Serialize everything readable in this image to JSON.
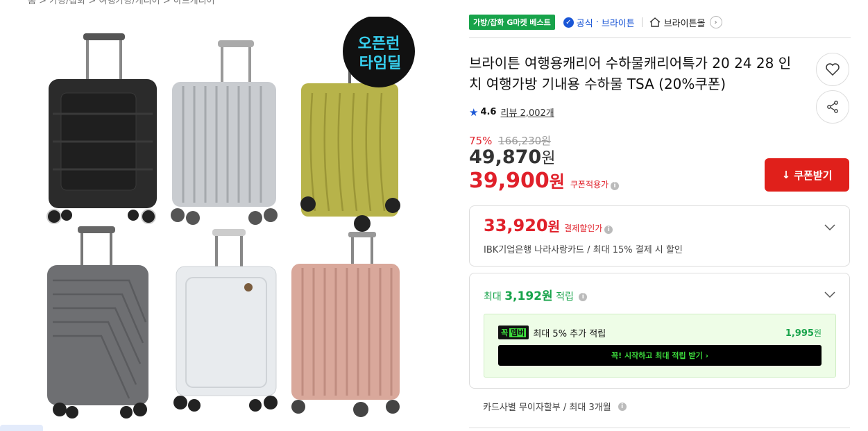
{
  "breadcrumb": {
    "text": "홈 > 가방/잡화 > 여행가방/캐리어 > 하드캐리어"
  },
  "badges": {
    "best": "가방/잡화 G마켓 베스트",
    "official": "공식",
    "brand": "브라이튼",
    "store": "브라이튼몰"
  },
  "product": {
    "title": "브라이튼 여행용캐리어 수하물캐리어특가 20 24 28 인치 여행가방 기내용 수하물 TSA (20%쿠폰)",
    "rating": "4.6",
    "reviews": "리뷰 2,002개"
  },
  "image": {
    "sticker_line1": "오픈런",
    "sticker_line2": "타임딜",
    "colors": [
      "#2b2b2b",
      "#c9ccd0",
      "#b7b34a",
      "#6e6f72",
      "#e8ebee",
      "#d9a89b"
    ]
  },
  "pricing": {
    "discount_pct": "75%",
    "original": "166,230원",
    "sale": "49,870",
    "sale_unit": "원",
    "coupon": "39,900",
    "coupon_unit": "원",
    "coupon_label": "쿠폰적용가",
    "coupon_button": "쿠폰받기"
  },
  "card_discount": {
    "price": "33,920",
    "unit": "원",
    "label": "결제할인가",
    "desc": "IBK기업은행 나라사랑카드 / 최대 15% 결제 시 할인"
  },
  "points": {
    "prefix": "최대 ",
    "amount": "3,192원",
    "suffix": " 적립",
    "member_logo_a": "꼭",
    "member_logo_b": "멤버",
    "member_text": "최대 5% 추가 적립",
    "member_amount": "1,995",
    "member_unit": "원",
    "cta": "꼭! 시작하고 최대 적립 받기  ›"
  },
  "installment": {
    "text": "카드사별 무이자할부 / 최대 3개월"
  }
}
